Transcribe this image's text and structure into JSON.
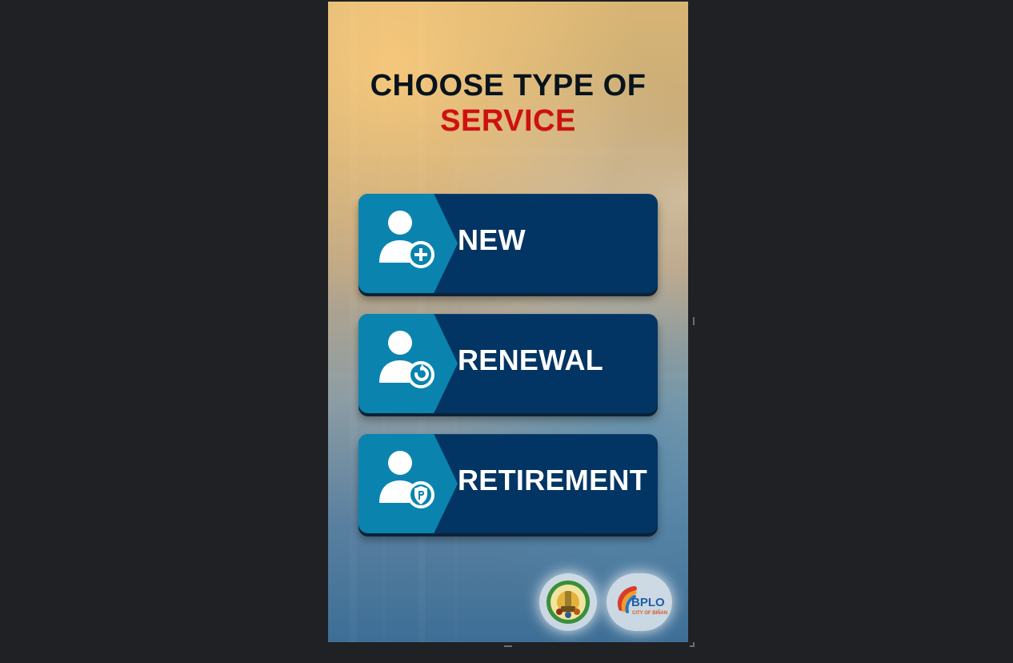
{
  "screen": {
    "title_line_1": "CHOOSE TYPE OF",
    "title_line_2": "SERVICE"
  },
  "buttons": [
    {
      "label": "NEW",
      "icon": "user-add-icon"
    },
    {
      "label": "RENEWAL",
      "icon": "user-renew-icon"
    },
    {
      "label": "RETIREMENT",
      "icon": "user-retire-icon"
    }
  ],
  "logos": {
    "seal": "city-seal-logo",
    "bplo": "bplo-logo",
    "bplo_text": "BPLO",
    "bplo_subtext": "CITY OF BIÑAN"
  },
  "colors": {
    "page_bg": "#202124",
    "button_main": "#023563",
    "button_accent": "#0a84af",
    "title_dark": "#08131c",
    "title_red": "#cf1010"
  }
}
